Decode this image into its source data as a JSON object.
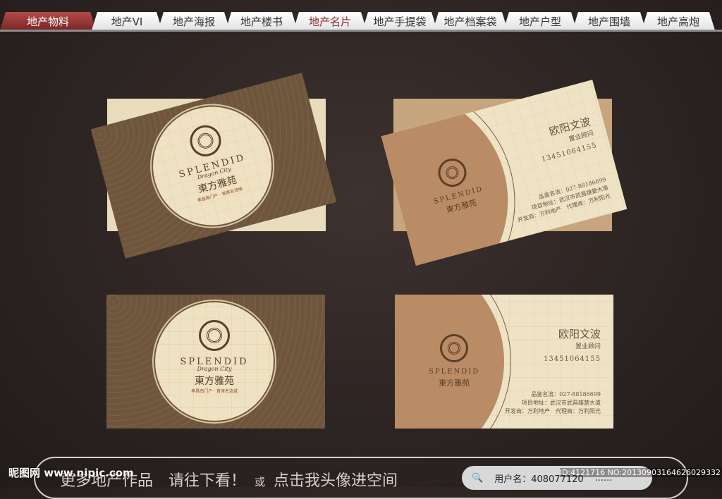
{
  "tabs": [
    "地产物料",
    "地产VI",
    "地产海报",
    "地产楼书",
    "地产名片",
    "地产手提袋",
    "地产档案袋",
    "地产户型",
    "地产围墙",
    "地产高炮"
  ],
  "card": {
    "brand": "SPLENDID",
    "brand_sub": "Dragon City",
    "cn_name": "東方雅苑",
    "tagline": "孝昌南门户 · 首席名流城",
    "person": "欧阳文波",
    "role": "置业顾问",
    "phone": "13451064155",
    "line1": "品鉴名流：027-88186699",
    "line2": "项目地址：武汉市武昌雄楚大道",
    "line3": "开发商：万利地产　代理商：万利阳光"
  },
  "bottom": {
    "text1": "更多地产作品　请往下看！",
    "or": "或",
    "text2": "点击我头像进空间",
    "user": "用户名：408077120",
    "dots": "......"
  },
  "watermark": {
    "site": "昵图网 www.nipic.com",
    "id": "ID:4121716 NO:20130903164626029332"
  },
  "colors": {
    "accent": "#8b2a2a",
    "card_brown": "#6e553b",
    "card_cream": "#efe3c6",
    "tan": "#b98c65"
  }
}
